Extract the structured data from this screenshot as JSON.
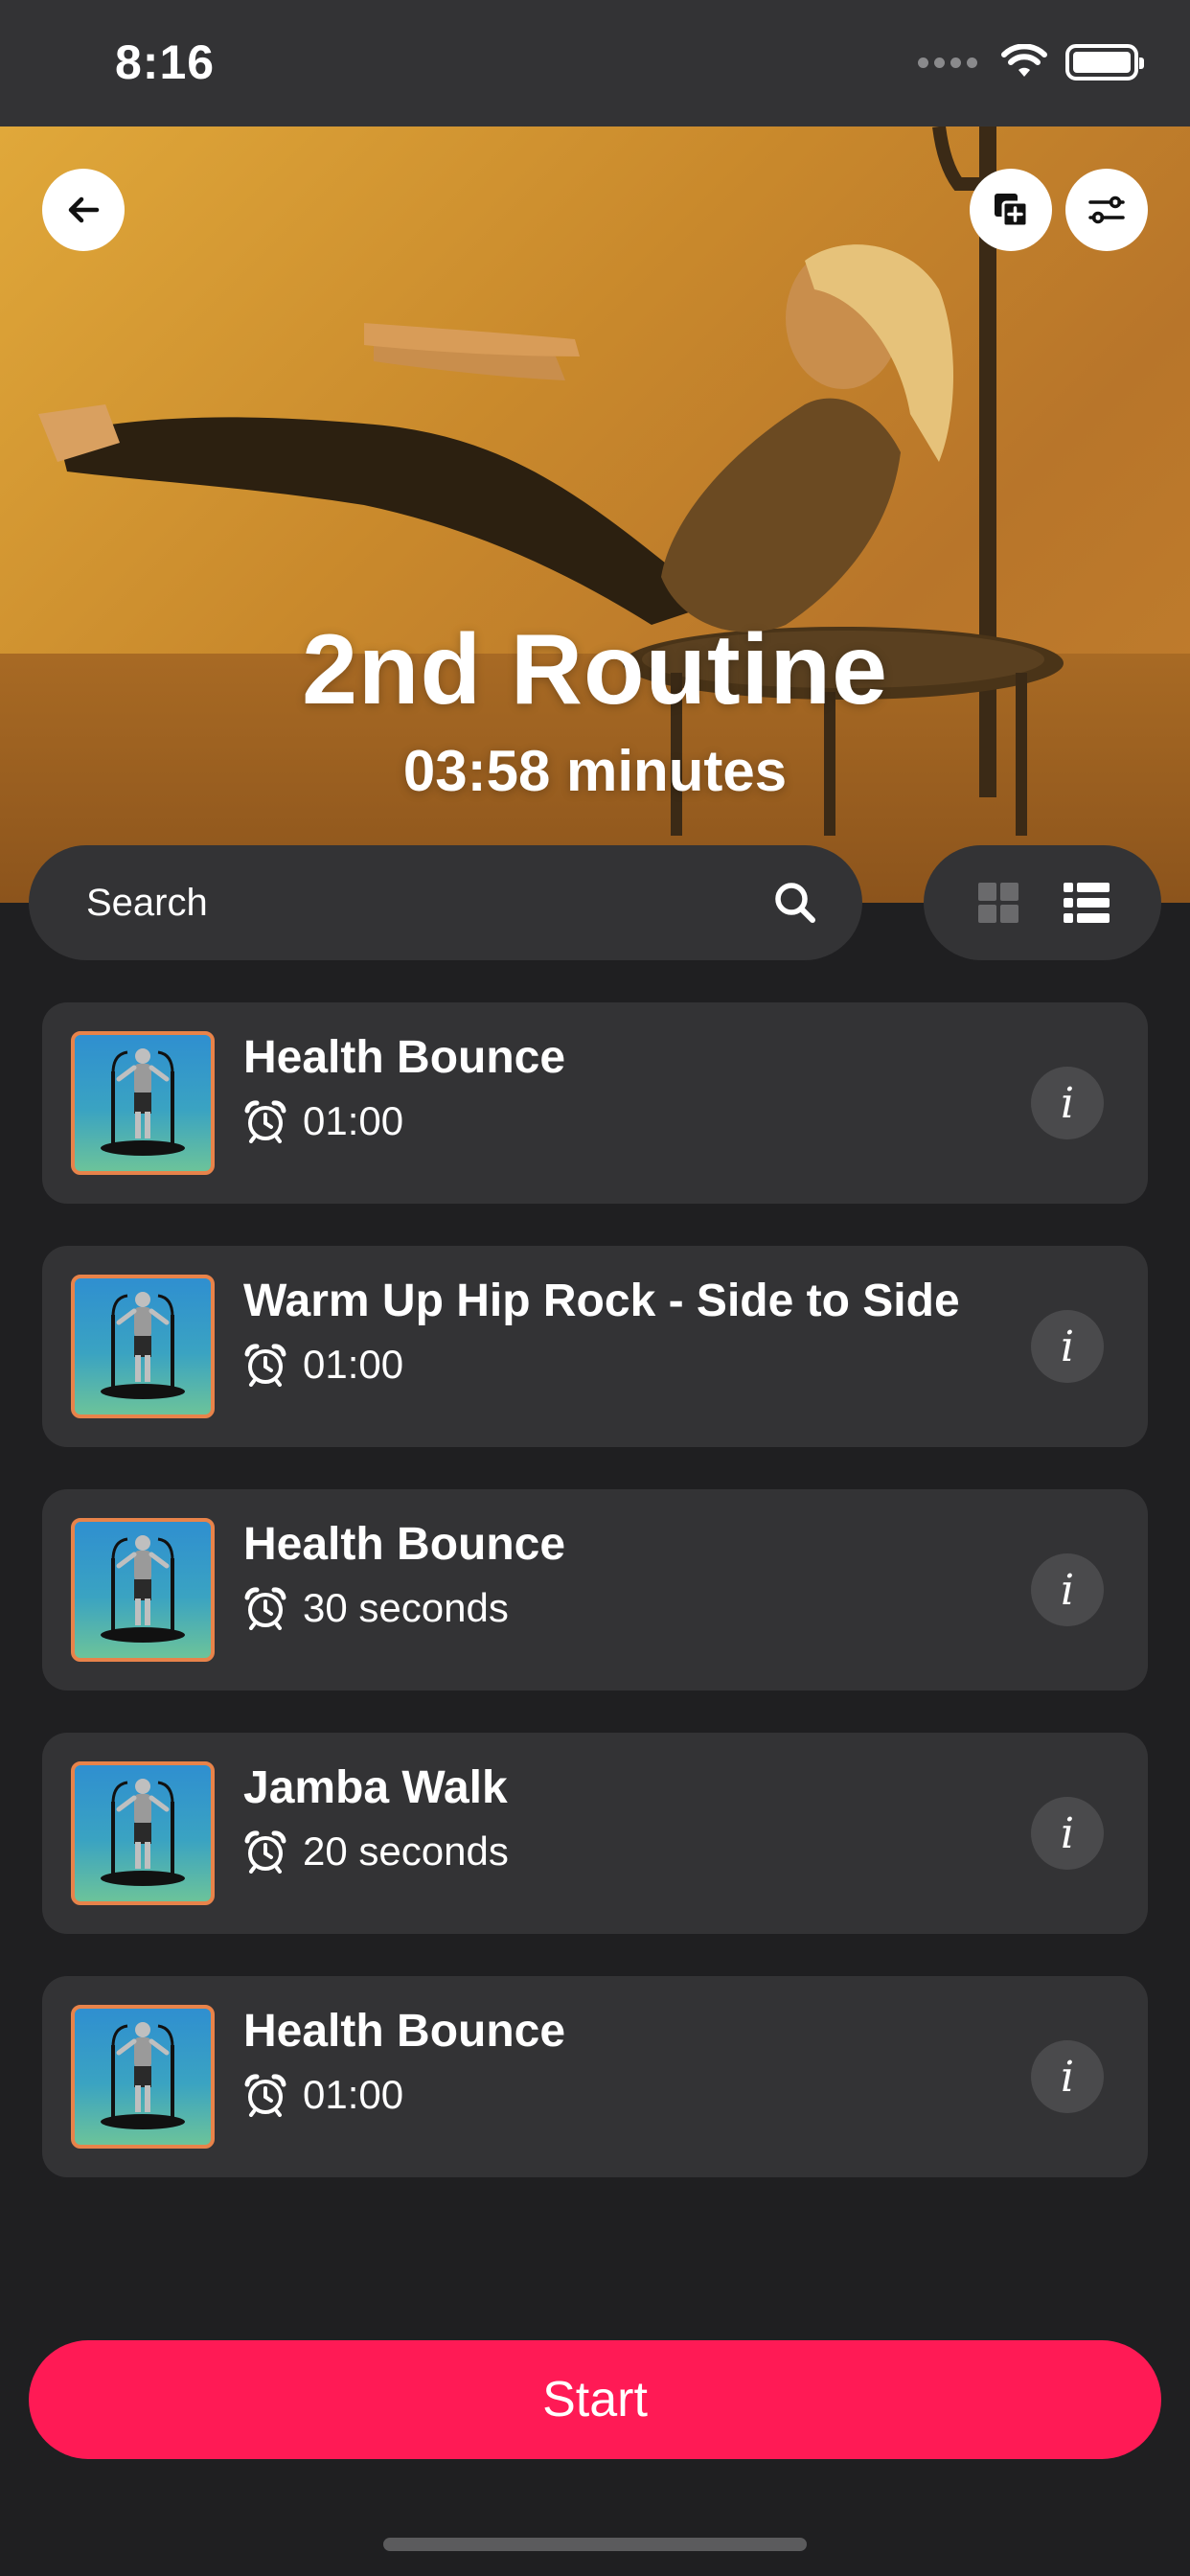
{
  "status_bar": {
    "time": "8:16"
  },
  "header": {
    "title": "2nd Routine",
    "subtitle": "03:58 minutes",
    "back_icon": "arrow-left-icon",
    "add_icon": "copy-add-icon",
    "filter_icon": "sliders-icon"
  },
  "search": {
    "placeholder": "Search",
    "icon": "search-icon"
  },
  "view_toggle": {
    "grid_icon": "grid-icon",
    "list_icon": "list-icon",
    "active": "list"
  },
  "exercises": [
    {
      "name": "Health Bounce",
      "duration": "01:00"
    },
    {
      "name": "Warm Up Hip Rock - Side to Side",
      "duration": "01:00"
    },
    {
      "name": "Health Bounce",
      "duration": "30 seconds"
    },
    {
      "name": "Jamba Walk",
      "duration": "20 seconds"
    },
    {
      "name": "Health Bounce",
      "duration": "01:00"
    }
  ],
  "info_label": "i",
  "start_button": {
    "label": "Start"
  },
  "colors": {
    "background": "#1f1f21",
    "card": "#333335",
    "accent": "#ff1a55",
    "hero": "#d8962f",
    "thumb_border": "#e8834a"
  }
}
